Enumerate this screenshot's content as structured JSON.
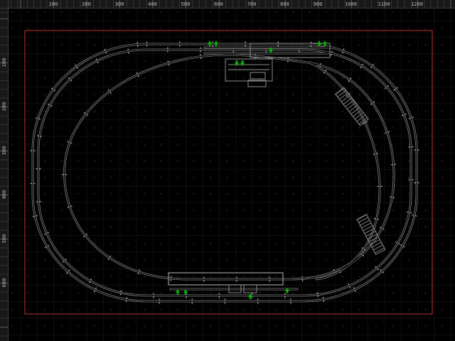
{
  "colors": {
    "background": "#000000",
    "grid_dot": "#2d2d2d",
    "ruler_background": "#181818",
    "ruler_text": "#b8b8b8",
    "board_outline": "#9c2a2a",
    "track": "#909090",
    "switch_arrow": "#00b400"
  },
  "rulers": {
    "top": {
      "labels": [
        "100",
        "200",
        "300",
        "400",
        "500",
        "600",
        "700",
        "800",
        "900",
        "1000",
        "1100",
        "1200"
      ]
    },
    "left": {
      "labels": [
        "100",
        "200",
        "300",
        "400",
        "500",
        "600"
      ]
    }
  }
}
